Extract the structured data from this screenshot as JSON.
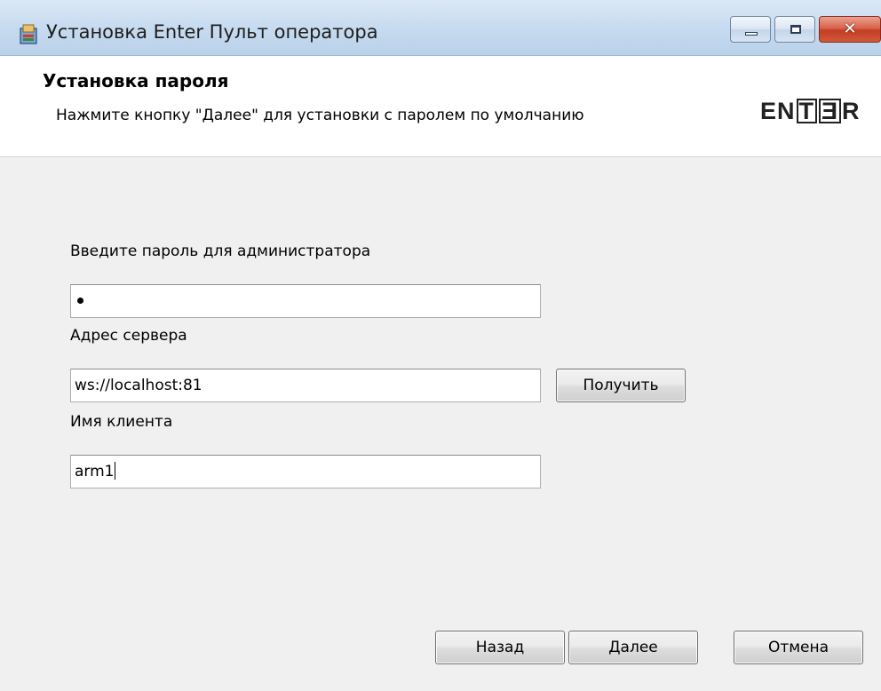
{
  "window": {
    "title": "Установка Enter Пульт оператора",
    "icon": "installer-icon",
    "close_glyph": "✕"
  },
  "header": {
    "title": "Установка пароля",
    "description": "Нажмите кнопку \"Далее\" для установки с паролем по умолчанию",
    "logo_text": "ENTER"
  },
  "form": {
    "password": {
      "label": "Введите пароль для администратора",
      "masked_chars": 1
    },
    "server": {
      "label": "Адрес сервера",
      "value": "ws://localhost:81",
      "button_label": "Получить"
    },
    "client": {
      "label": "Имя клиента",
      "value": "arm1"
    }
  },
  "footer": {
    "back_label": "Назад",
    "next_label": "Далее",
    "cancel_label": "Отмена"
  }
}
